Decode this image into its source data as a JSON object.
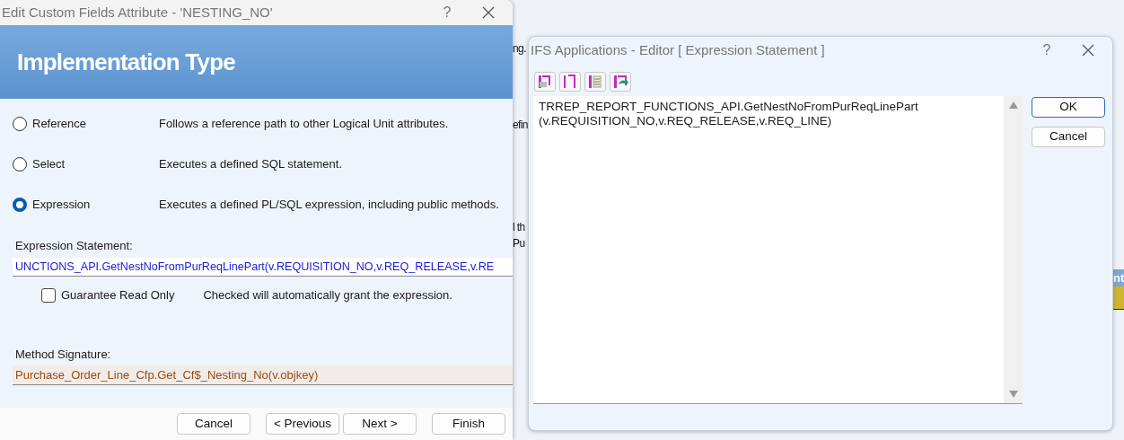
{
  "background_window": {
    "fragments": [
      "ng.",
      "efin",
      "l th",
      "Pu"
    ],
    "column_header": "nt"
  },
  "left_dialog": {
    "title": "Edit Custom Fields Attribute - 'NESTING_NO'",
    "help": "?",
    "header": "Implementation Type",
    "options": [
      {
        "label": "Reference",
        "description": "Follows a reference path to other Logical Unit attributes.",
        "selected": false
      },
      {
        "label": "Select",
        "description": "Executes a defined SQL statement.",
        "selected": false
      },
      {
        "label": "Expression",
        "description": "Executes a defined PL/SQL expression, including public methods.",
        "selected": true
      }
    ],
    "expression_statement": {
      "label": "Expression Statement:",
      "value": "UNCTIONS_API.GetNestNoFromPurReqLinePart(v.REQUISITION_NO,v.REQ_RELEASE,v.RE"
    },
    "guarantee_read_only": {
      "label": "Guarantee Read Only",
      "checked": false,
      "note": "Checked will automatically grant the expression."
    },
    "method_signature": {
      "label": "Method Signature:",
      "value": "Purchase_Order_Line_Cfp.Get_Cf$_Nesting_No(v.objkey)"
    },
    "buttons": [
      "Cancel",
      "< Previous",
      "Next >",
      "Finish"
    ]
  },
  "editor_dialog": {
    "title": "IFS Applications - Editor [ Expression Statement ]",
    "help": "?",
    "text_lines": [
      "TRREP_REPORT_FUNCTIONS_API.GetNestNoFromPurReqLinePart",
      "(v.REQUISITION_NO,v.REQ_RELEASE,v.REQ_LINE)"
    ],
    "buttons": [
      {
        "label": "OK",
        "default": true
      },
      {
        "label": "Cancel",
        "default": false
      }
    ]
  }
}
